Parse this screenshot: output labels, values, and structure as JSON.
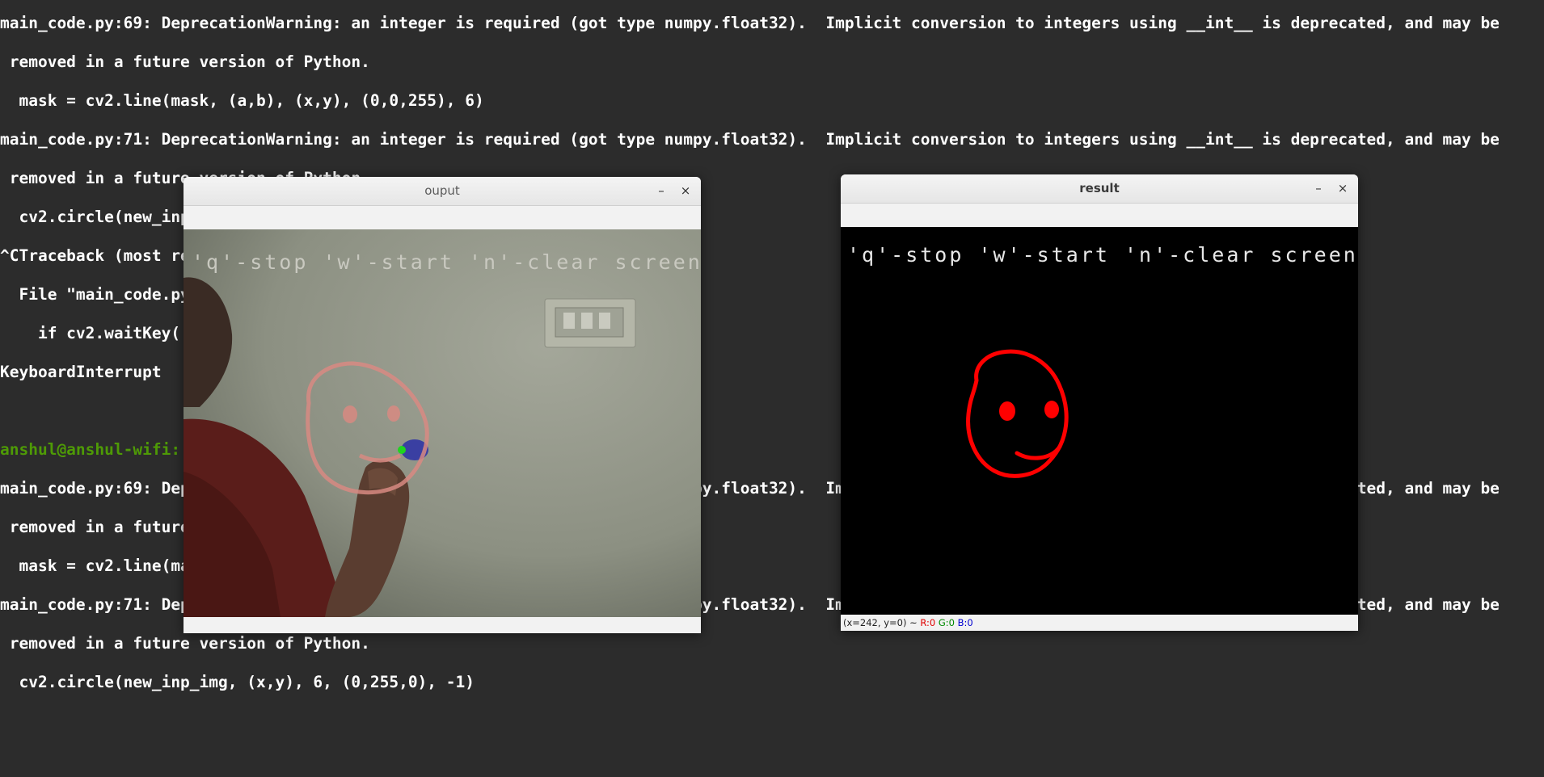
{
  "terminal": {
    "lines": [
      "main_code.py:69: DeprecationWarning: an integer is required (got type numpy.float32).  Implicit conversion to integers using __int__ is deprecated, and may be",
      " removed in a future version of Python.",
      "  mask = cv2.line(mask, (a,b), (x,y), (0,0,255), 6)",
      "main_code.py:71: DeprecationWarning: an integer is required (got type numpy.float32).  Implicit conversion to integers using __int__ is deprecated, and may be",
      " removed in a future version of Python.",
      "  cv2.circle(new_inp_img, (x,y), 6, (0,255,0), -1)",
      "^CTraceback (most recent call last):",
      "  File \"main_code.py\"",
      "    if cv2.waitKey(",
      "KeyboardInterrupt",
      "",
      "",
      "main_code.py:69: DeprecationWarning: an integer is required (got type numpy.float32).  Implicit conversion to integers using __int__ is deprecated, and may be",
      " removed in a future version of Python.",
      "  mask = cv2.line(mask, (a,b), (x,y), (0,0,255), 6)",
      "main_code.py:71: DeprecationWarning: an integer is required (got type numpy.float32).  Implicit conversion to integers using __int__ is deprecated, and may be",
      " removed in a future version of Python.",
      "  cv2.circle(new_inp_img, (x,y), 6, (0,255,0), -1)"
    ],
    "prompt_user": "anshul@anshul-wifi:",
    "colors": {
      "background": "#2c2c2c",
      "text": "#ffffff",
      "prompt": "#4e9a06"
    }
  },
  "output_window": {
    "title": "ouput",
    "minimize_glyph": "–",
    "close_glyph": "×",
    "overlay_text": "'q'-stop 'w'-start 'n'-clear screen"
  },
  "result_window": {
    "title": "result",
    "minimize_glyph": "–",
    "close_glyph": "×",
    "overlay_text": "'q'-stop 'w'-start 'n'-clear screen",
    "status": {
      "coords": "(x=242, y=0) ~ ",
      "r": "R:0",
      "g": "G:0",
      "b": "B:0"
    },
    "colors": {
      "drawing": "#ff0000",
      "background": "#000000"
    }
  }
}
